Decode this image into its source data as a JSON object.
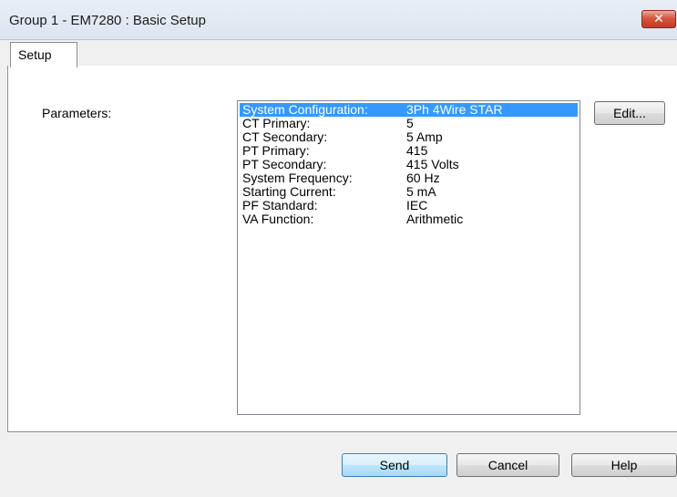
{
  "window": {
    "title": "Group 1 - EM7280 : Basic Setup",
    "close_label": "✕"
  },
  "tabs": [
    {
      "label": "Setup",
      "selected": true
    }
  ],
  "setup": {
    "parameters_label": "Parameters:",
    "parameters": [
      {
        "name": "System Configuration:",
        "value": "3Ph 4Wire STAR",
        "selected": true
      },
      {
        "name": "CT Primary:",
        "value": "5"
      },
      {
        "name": "CT Secondary:",
        "value": "5 Amp"
      },
      {
        "name": "PT Primary:",
        "value": "415"
      },
      {
        "name": "PT Secondary:",
        "value": "415 Volts"
      },
      {
        "name": "System Frequency:",
        "value": "60 Hz"
      },
      {
        "name": "Starting Current:",
        "value": "5 mA"
      },
      {
        "name": "PF Standard:",
        "value": "IEC"
      },
      {
        "name": "VA Function:",
        "value": "Arithmetic"
      }
    ],
    "edit_label": "Edit..."
  },
  "footer": {
    "send_label": "Send",
    "cancel_label": "Cancel",
    "help_label": "Help"
  },
  "colors": {
    "selection": "#3399ff",
    "close_button": "#c13a25"
  }
}
